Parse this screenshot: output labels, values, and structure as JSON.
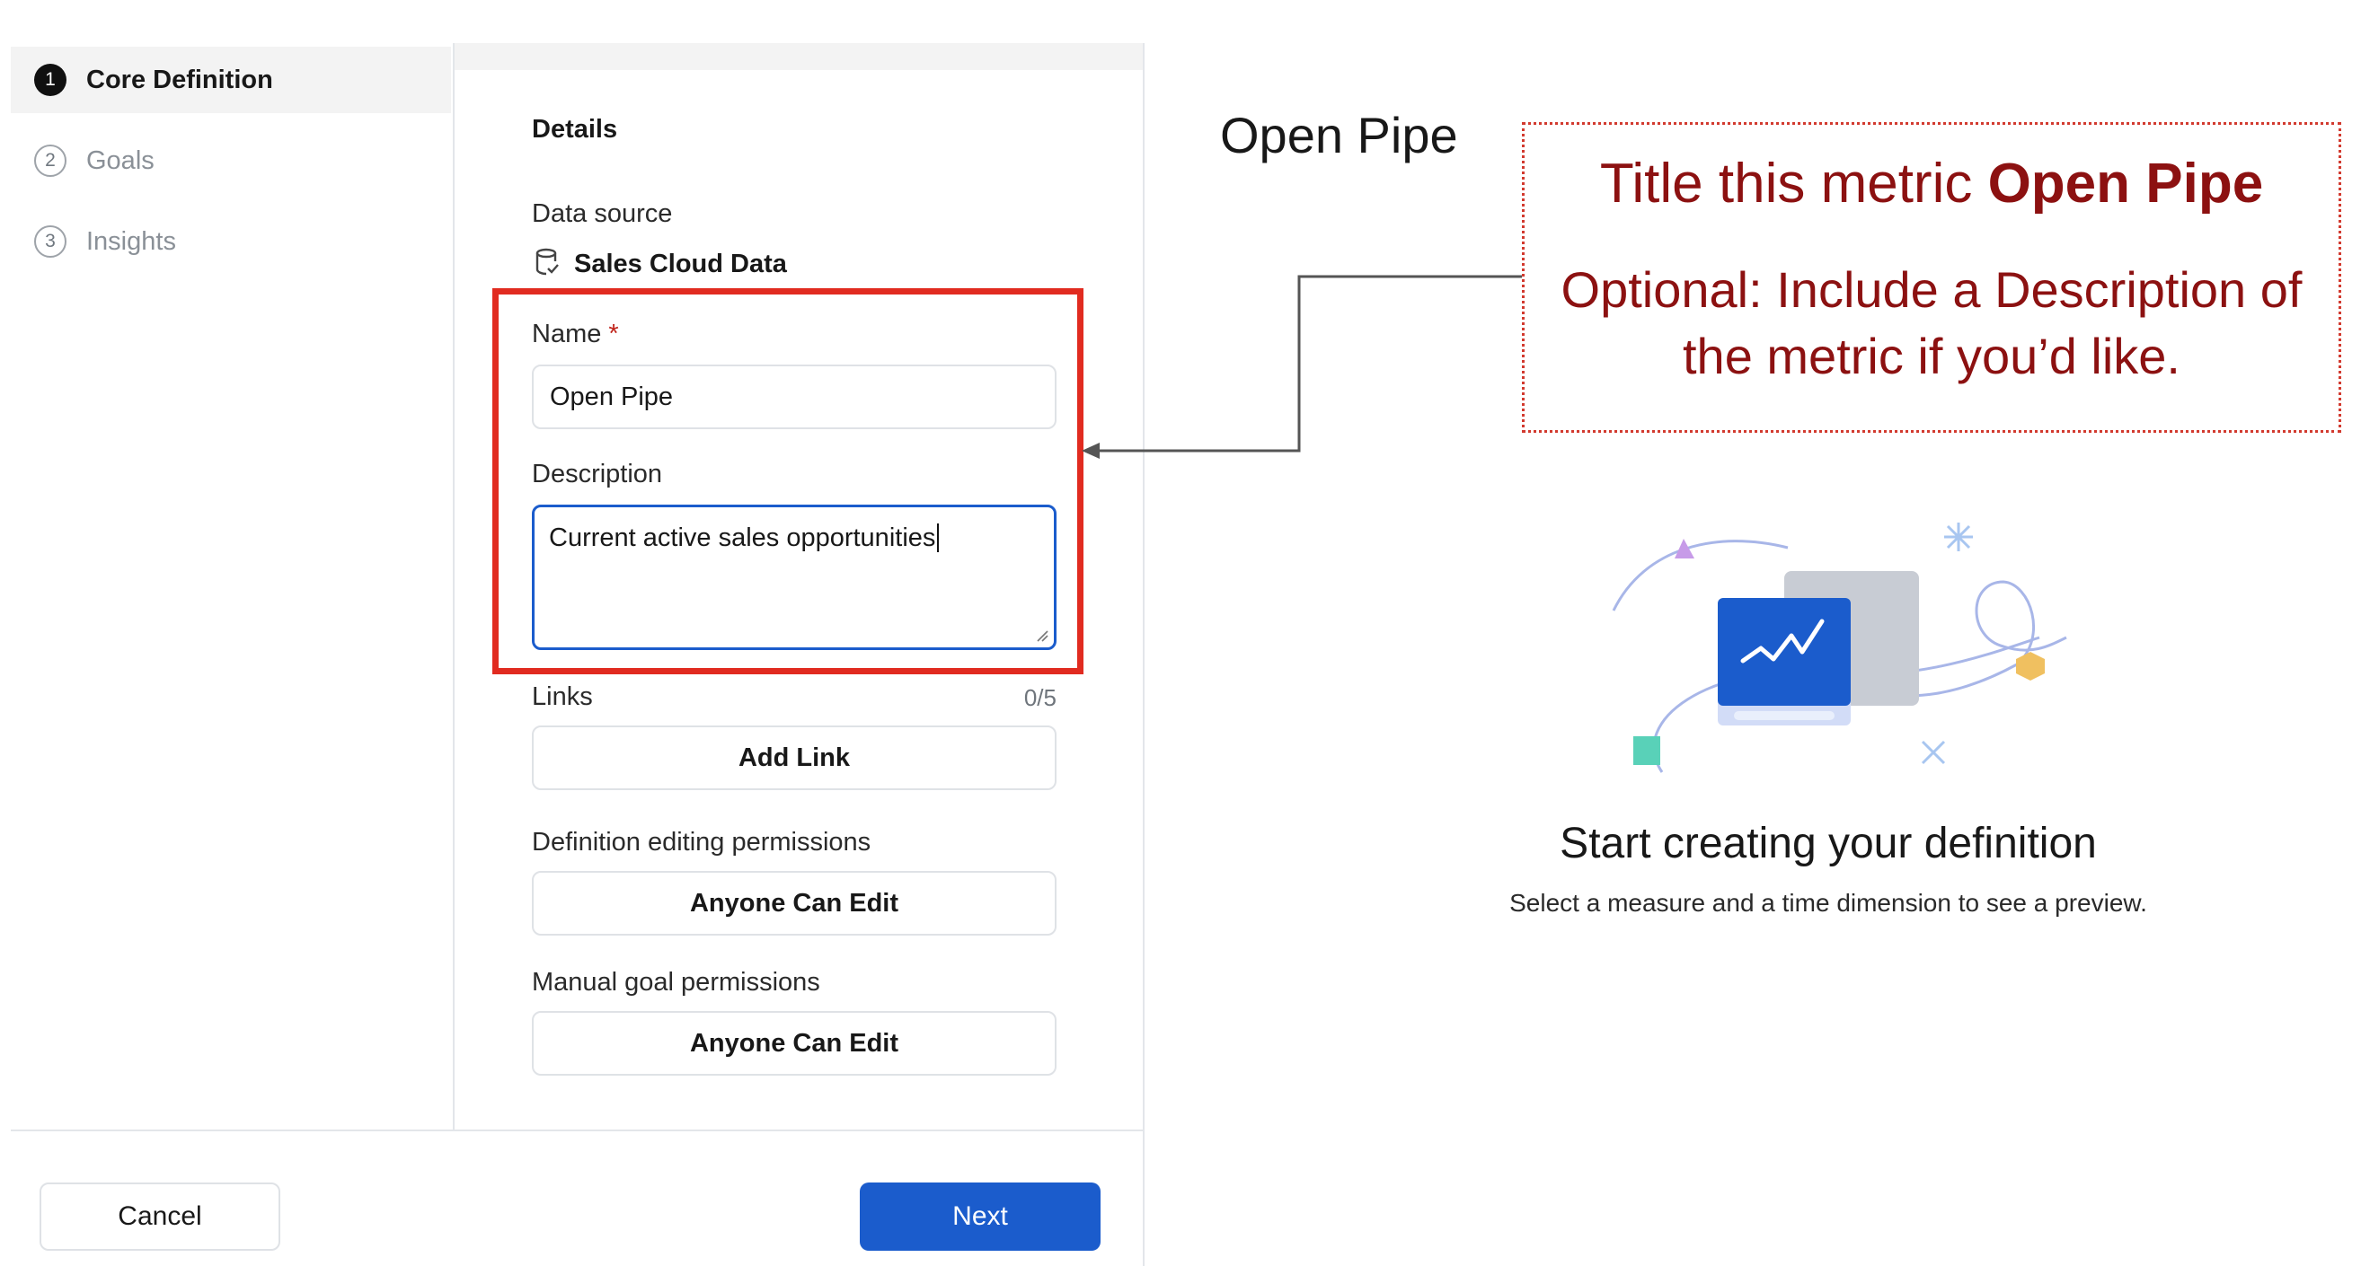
{
  "steps": [
    {
      "num": "1",
      "label": "Core Definition"
    },
    {
      "num": "2",
      "label": "Goals"
    },
    {
      "num": "3",
      "label": "Insights"
    }
  ],
  "form": {
    "section_title": "Details",
    "data_source_label": "Data source",
    "data_source_value": "Sales Cloud Data",
    "name_label": "Name",
    "required_mark": "*",
    "name_value": "Open Pipe",
    "description_label": "Description",
    "description_value": "Current active sales opportunities",
    "links_label": "Links",
    "links_count": "0/5",
    "add_link_label": "Add Link",
    "editing_permissions_label": "Definition editing permissions",
    "editing_permissions_value": "Anyone Can Edit",
    "goal_permissions_label": "Manual goal permissions",
    "goal_permissions_value": "Anyone Can Edit"
  },
  "footer": {
    "cancel_label": "Cancel",
    "next_label": "Next"
  },
  "preview": {
    "metric_title": "Open Pipe",
    "empty_title": "Start creating your definition",
    "empty_subtitle": "Select a measure and a time dimension to see a preview."
  },
  "callout": {
    "line1_prefix": "Title this metric ",
    "line1_bold": "Open Pipe",
    "line2": "Optional: Include a Description of the metric if you’d like."
  },
  "colors": {
    "accent": "#1b5ccc",
    "highlight": "#e12b20",
    "callout_text": "#8c1111"
  },
  "icons": [
    "database-icon",
    "resize-handle-icon",
    "empty-state-illustration"
  ]
}
